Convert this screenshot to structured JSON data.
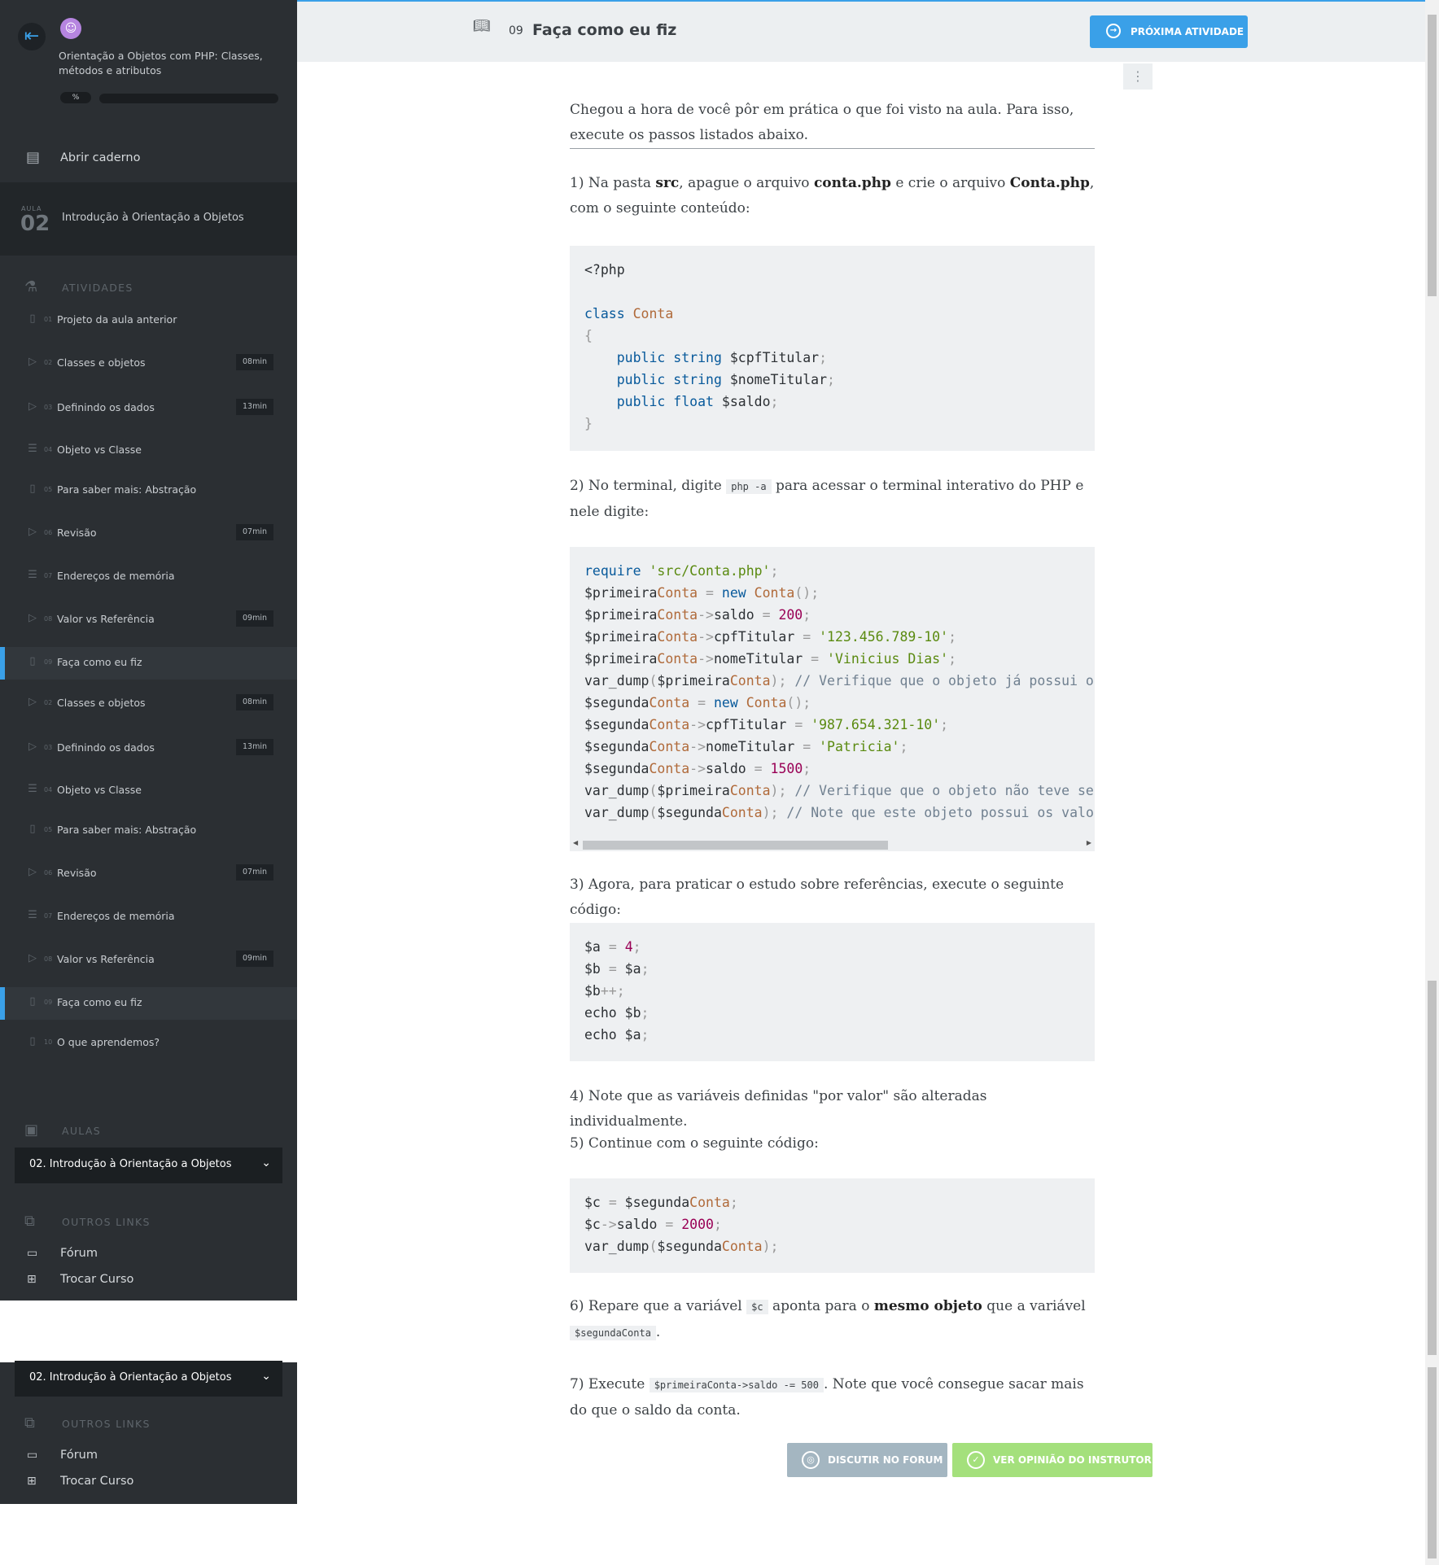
{
  "sidebar": {
    "course_title": "Orientação a Objetos com PHP: Classes, métodos e atributos",
    "progress_label": "%",
    "progress": 0,
    "open_notebook": "Abrir caderno",
    "lesson": {
      "aula_label": "AULA",
      "number": "02",
      "title": "Introdução à Orientação a Objetos"
    },
    "activities_header": "ATIVIDADES",
    "activities": [
      {
        "num": "01",
        "label": "Projeto da aula anterior",
        "duration": "",
        "icon": "book-icon"
      },
      {
        "num": "02",
        "label": "Classes e objetos",
        "duration": "08min",
        "icon": "video-icon"
      },
      {
        "num": "03",
        "label": "Definindo os dados",
        "duration": "13min",
        "icon": "video-icon"
      },
      {
        "num": "04",
        "label": "Objeto vs Classe",
        "duration": "",
        "icon": "list-icon"
      },
      {
        "num": "05",
        "label": "Para saber mais: Abstração",
        "duration": "",
        "icon": "book-icon"
      },
      {
        "num": "06",
        "label": "Revisão",
        "duration": "07min",
        "icon": "video-icon"
      },
      {
        "num": "07",
        "label": "Endereços de memória",
        "duration": "",
        "icon": "list-icon"
      },
      {
        "num": "08",
        "label": "Valor vs Referência",
        "duration": "09min",
        "icon": "video-icon"
      },
      {
        "num": "09",
        "label": "Faça como eu fiz",
        "duration": "",
        "icon": "book-icon"
      },
      {
        "num": "02",
        "label": "Classes e objetos",
        "duration": "08min",
        "icon": "video-icon"
      },
      {
        "num": "03",
        "label": "Definindo os dados",
        "duration": "13min",
        "icon": "video-icon"
      },
      {
        "num": "04",
        "label": "Objeto vs Classe",
        "duration": "",
        "icon": "list-icon"
      },
      {
        "num": "05",
        "label": "Para saber mais: Abstração",
        "duration": "",
        "icon": "book-icon"
      },
      {
        "num": "06",
        "label": "Revisão",
        "duration": "07min",
        "icon": "video-icon"
      },
      {
        "num": "07",
        "label": "Endereços de memória",
        "duration": "",
        "icon": "list-icon"
      },
      {
        "num": "08",
        "label": "Valor vs Referência",
        "duration": "09min",
        "icon": "video-icon"
      },
      {
        "num": "09",
        "label": "Faça como eu fiz",
        "duration": "",
        "icon": "book-icon"
      },
      {
        "num": "10",
        "label": "O que aprendemos?",
        "duration": "",
        "icon": "book-icon"
      }
    ],
    "aulas_header": "AULAS",
    "aulas_selected": "02. Introdução à Orientação a Objetos",
    "links_header": "OUTROS LINKS",
    "links": [
      {
        "label": "Fórum",
        "icon": "chat-icon"
      },
      {
        "label": "Trocar Curso",
        "icon": "switch-icon"
      }
    ]
  },
  "header": {
    "activity_number": "09",
    "activity_title": "Faça como eu fiz",
    "next_button": "PRÓXIMA ATIVIDADE"
  },
  "content": {
    "intro": "Chegou a hora de você pôr em prática o que foi visto na aula. Para isso, execute os passos listados abaixo.",
    "step1": {
      "a": "1) Na pasta ",
      "b": "src",
      "c": ", apague o arquivo ",
      "d": "conta.php",
      "e": " e crie o arquivo ",
      "f": "Conta.php",
      "g": ", com o seguinte conteúdo:"
    },
    "step2": {
      "a": "2) No terminal, digite ",
      "code": "php -a",
      "b": " para acessar o terminal interativo do PHP e nele digite:"
    },
    "step3": "3) Agora, para praticar o estudo sobre referências, execute o seguinte código:",
    "step4": "4) Note que as variáveis definidas \"por valor\" são alteradas individualmente.",
    "step5": "5) Continue com o seguinte código:",
    "step6": {
      "a": "6) Repare que a variável ",
      "code1": "$c",
      "b": " aponta para o ",
      "c": "mesmo objeto",
      "d": " que a variável ",
      "code2": "$segundaConta",
      "e": "."
    },
    "step7": {
      "a": "7) Execute ",
      "code": "$primeiraConta->saldo -= 500",
      "b": ". Note que você consegue sacar mais do que o saldo da conta."
    },
    "code1": "<?php\n\nclass Conta\n{\n    public string $cpfTitular;\n    public string $nomeTitular;\n    public float $saldo;\n}",
    "code2": "require 'src/Conta.php';\n$primeiraConta = new Conta();\n$primeiraConta->saldo = 200;\n$primeiraConta->cpfTitular = '123.456.789-10';\n$primeiraConta->nomeTitular = 'Vinicius Dias';\nvar_dump($primeiraConta); // Verifique que o objeto já possui o\n$segundaConta = new Conta();\n$segundaConta->cpfTitular = '987.654.321-10';\n$segundaConta->nomeTitular = 'Patricia';\n$segundaConta->saldo = 1500;\nvar_dump($primeiraConta); // Verifique que o objeto não teve se\nvar_dump($segundaConta); // Note que este objeto possui os valo",
    "code3": "$a = 4;\n$b = $a;\n$b++;\necho $b;\necho $a;",
    "code4": "$c = $segundaConta;\n$c->saldo = 2000;\nvar_dump($segundaConta);"
  },
  "actions": {
    "forum_button": "DISCUTIR NO FORUM",
    "opinion_button": "VER OPINIÃO DO INSTRUTOR"
  },
  "colors": {
    "accent": "#3aa0e8",
    "sidebar_bg": "#2b2f33",
    "opinion_green": "#a4e07c",
    "forum_gray": "#a4b6c1"
  }
}
